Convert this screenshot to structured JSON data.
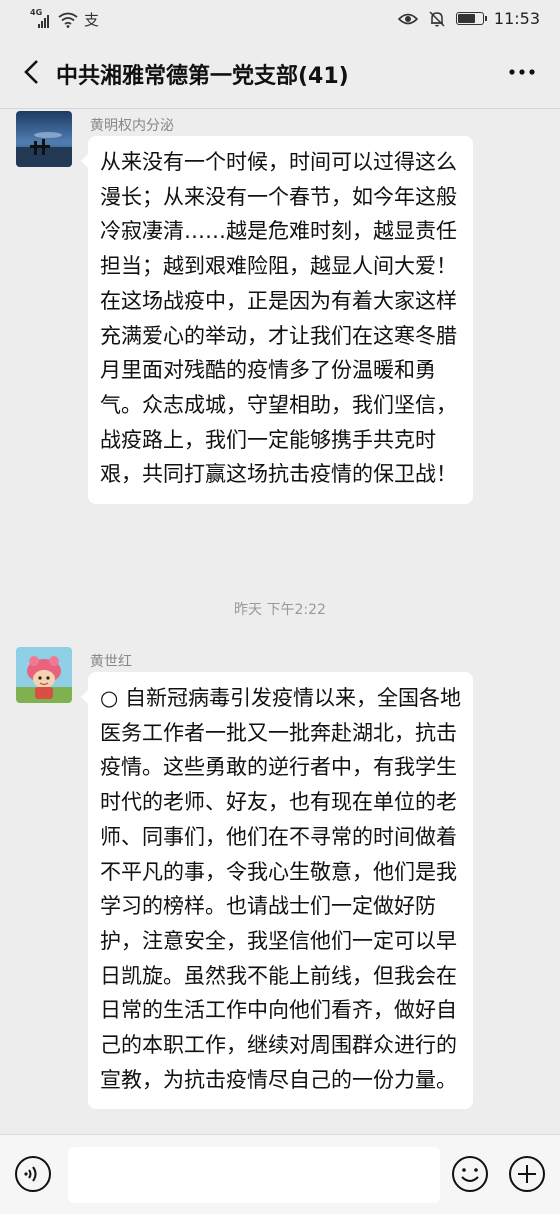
{
  "status_bar": {
    "network_label": "4G",
    "carrier_glyph": "支",
    "time": "11:53",
    "battery_level": 0.75
  },
  "header": {
    "title": "中共湘雅常德第一党支部(41)"
  },
  "messages": [
    {
      "sender": "黄明权内分泌",
      "text": "从来没有一个时候，时间可以过得这么漫长；从来没有一个春节，如今年这般冷寂凄清……越是危难时刻，越显责任担当；越到艰难险阻，越显人间大爱！在这场战疫中，正是因为有着大家这样充满爱心的举动，才让我们在这寒冬腊月里面对残酷的疫情多了份温暖和勇气。众志成城，守望相助，我们坚信，战疫路上，我们一定能够携手共克时艰，共同打赢这场抗击疫情的保卫战！"
    },
    {
      "sender": "黄世红",
      "text": "○ 自新冠病毒引发疫情以来，全国各地医务工作者一批又一批奔赴湖北，抗击疫情。这些勇敢的逆行者中，有我学生时代的老师、好友，也有现在单位的老师、同事们，他们在不寻常的时间做着不平凡的事，令我心生敬意，他们是我学习的榜样。也请战士们一定做好防护，注意安全，我坚信他们一定可以早日凯旋。虽然我不能上前线，但我会在日常的生活工作中向他们看齐，做好自己的本职工作，继续对周围群众进行的宣教，为抗击疫情尽自己的一份力量。"
    }
  ],
  "timestamp": "昨天 下午2:22",
  "input_bar": {
    "placeholder": ""
  }
}
